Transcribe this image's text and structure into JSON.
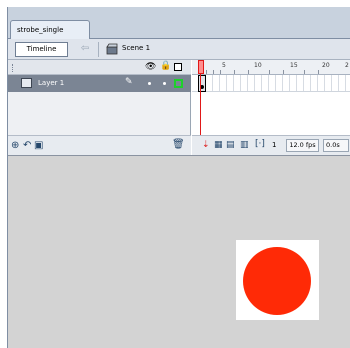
{
  "document": {
    "tab_title": "strobe_single"
  },
  "toolbar": {
    "timeline_label": "Timeline",
    "scene_label": "Scene 1"
  },
  "timeline": {
    "layers": [
      {
        "name": "Layer 1"
      }
    ],
    "ruler_numbers": [
      "1",
      "5",
      "10",
      "15",
      "20",
      "2"
    ],
    "current_frame": "1",
    "frame_rate": "12.0 fps",
    "elapsed": "0.0s"
  },
  "stage": {
    "circle_color": "#ff2a06",
    "background": "#ffffff"
  },
  "colors": {
    "selected_layer": "#7b8594",
    "playhead": "#e01818",
    "outline_green": "#1ed12b"
  }
}
